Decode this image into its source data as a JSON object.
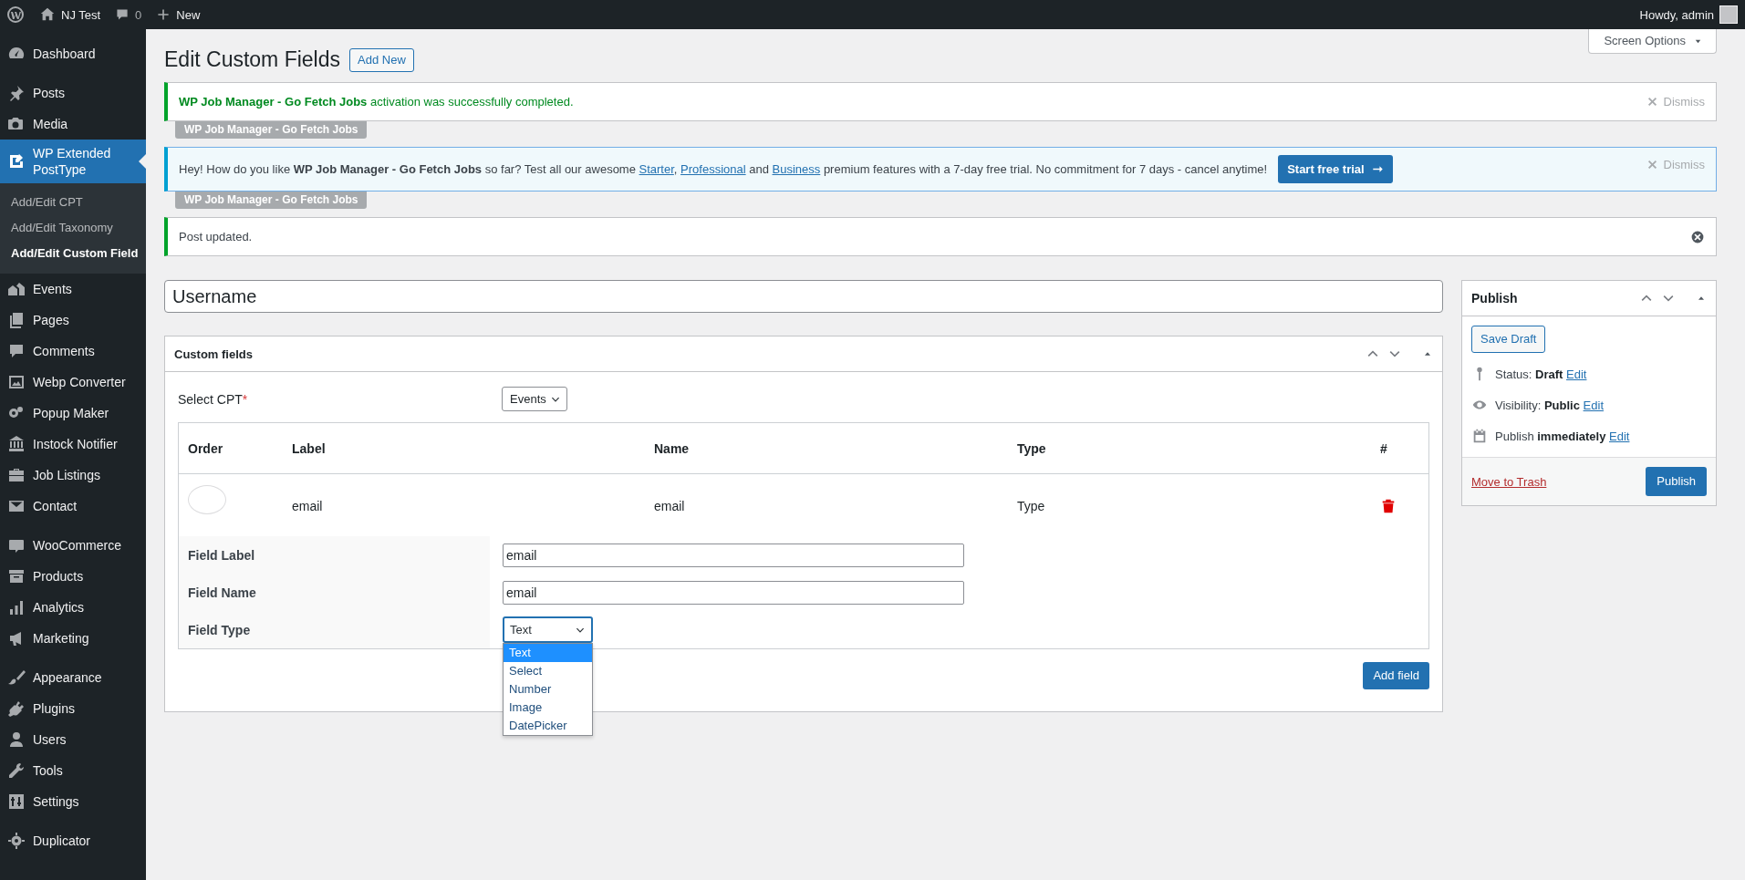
{
  "admin_bar": {
    "site_name": "NJ Test",
    "comment_count": "0",
    "new_label": "New",
    "greeting": "Howdy, admin"
  },
  "sidebar": {
    "groups": [
      {
        "items": [
          {
            "label": "Dashboard",
            "selected": false
          }
        ]
      },
      {
        "items": [
          {
            "label": "Posts",
            "selected": false
          },
          {
            "label": "Media",
            "selected": false
          },
          {
            "label": "WP Extended PostType",
            "selected": true,
            "children": [
              {
                "label": "Add/Edit CPT",
                "selected": false
              },
              {
                "label": "Add/Edit Taxonomy",
                "selected": false
              },
              {
                "label": "Add/Edit Custom Field",
                "selected": true
              }
            ]
          },
          {
            "label": "Events",
            "selected": false
          },
          {
            "label": "Pages",
            "selected": false
          },
          {
            "label": "Comments",
            "selected": false
          },
          {
            "label": "Webp Converter",
            "selected": false
          },
          {
            "label": "Popup Maker",
            "selected": false
          },
          {
            "label": "Instock Notifier",
            "selected": false
          },
          {
            "label": "Job Listings",
            "selected": false
          },
          {
            "label": "Contact",
            "selected": false
          }
        ]
      },
      {
        "items": [
          {
            "label": "WooCommerce",
            "selected": false
          },
          {
            "label": "Products",
            "selected": false
          },
          {
            "label": "Analytics",
            "selected": false
          },
          {
            "label": "Marketing",
            "selected": false
          }
        ]
      },
      {
        "items": [
          {
            "label": "Appearance",
            "selected": false
          },
          {
            "label": "Plugins",
            "selected": false
          },
          {
            "label": "Users",
            "selected": false
          },
          {
            "label": "Tools",
            "selected": false
          },
          {
            "label": "Settings",
            "selected": false
          }
        ]
      },
      {
        "items": [
          {
            "label": "Duplicator",
            "selected": false
          }
        ]
      }
    ]
  },
  "screen_options": "Screen Options",
  "page_title": "Edit Custom Fields",
  "add_new": "Add New",
  "notices": [
    {
      "kind": "success",
      "text": "**WP Job Manager - Go Fetch Jobs** activation was successfully completed.",
      "dismiss": "Dismiss",
      "tag": "WP Job Manager - Go Fetch Jobs"
    },
    {
      "kind": "promo",
      "segments": [
        {
          "kind": "text",
          "text": "Hey! How do you like **WP Job Manager - Go Fetch Jobs** so far? Test all our awesome "
        },
        {
          "kind": "link",
          "text": "Starter"
        },
        {
          "kind": "text",
          "text": ", "
        },
        {
          "kind": "link",
          "text": "Professional"
        },
        {
          "kind": "text",
          "text": " and "
        },
        {
          "kind": "link",
          "text": "Business"
        },
        {
          "kind": "text",
          "text": " premium features with a 7-day free trial. No commitment for 7 days - cancel anytime!"
        }
      ],
      "button": "Start free trial",
      "dismiss": "Dismiss",
      "tag": "WP Job Manager - Go Fetch Jobs"
    },
    {
      "kind": "updated",
      "text": "Post updated."
    }
  ],
  "title_field": {
    "value": "Username"
  },
  "custom_fields_box": {
    "title": "Custom fields",
    "cpt_label": "Select CPT",
    "cpt_required": "*",
    "cpt_value": "Events",
    "table": {
      "columns": [
        "Order",
        "Label",
        "Name",
        "Type",
        "#"
      ],
      "rows": [
        {
          "label": "email",
          "name": "email",
          "type": "Type",
          "editor": [
            {
              "kind": "text",
              "label": "Field Label",
              "value": "email"
            },
            {
              "kind": "text",
              "label": "Field Name",
              "value": "email"
            },
            {
              "kind": "select",
              "label": "Field Type",
              "value": "Text",
              "options": [
                {
                  "label": "Text",
                  "selected": true
                },
                {
                  "label": "Select",
                  "selected": false
                },
                {
                  "label": "Number",
                  "selected": false
                },
                {
                  "label": "Image",
                  "selected": false
                },
                {
                  "label": "DatePicker",
                  "selected": false
                }
              ]
            }
          ]
        }
      ]
    },
    "add_button": "Add field"
  },
  "publish_box": {
    "title": "Publish",
    "save_draft": "Save Draft",
    "rows": [
      {
        "text": "Status: **Draft**",
        "link": "Edit"
      },
      {
        "text": "Visibility: **Public**",
        "link": "Edit"
      },
      {
        "text": "Publish **immediately**",
        "link": "Edit"
      }
    ],
    "trash_link": "Move to Trash",
    "publish_button": "Publish"
  }
}
